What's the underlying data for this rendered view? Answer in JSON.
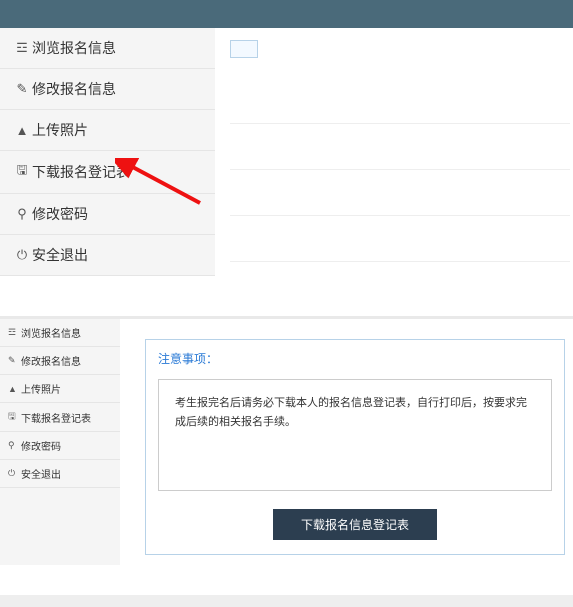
{
  "sidebar_top": {
    "items": [
      {
        "icon": "☲",
        "label": "浏览报名信息"
      },
      {
        "icon": "✎",
        "label": "修改报名信息"
      },
      {
        "icon": "▲",
        "label": "上传照片"
      },
      {
        "icon": "🖫",
        "label": "下载报名登记表"
      },
      {
        "icon": "⚲",
        "label": "修改密码"
      },
      {
        "icon": "⏻",
        "label": "安全退出"
      }
    ]
  },
  "sidebar_bottom": {
    "items": [
      {
        "icon": "☲",
        "label": "浏览报名信息"
      },
      {
        "icon": "✎",
        "label": "修改报名信息"
      },
      {
        "icon": "▲",
        "label": "上传照片"
      },
      {
        "icon": "🖫",
        "label": "下载报名登记表"
      },
      {
        "icon": "⚲",
        "label": "修改密码"
      },
      {
        "icon": "⏻",
        "label": "安全退出"
      }
    ]
  },
  "panel": {
    "title": "注意事项：",
    "notice": "考生报完名后请务必下载本人的报名信息登记表，自行打印后，按要求完成后续的相关报名手续。",
    "download_button": "下载报名信息登记表"
  }
}
